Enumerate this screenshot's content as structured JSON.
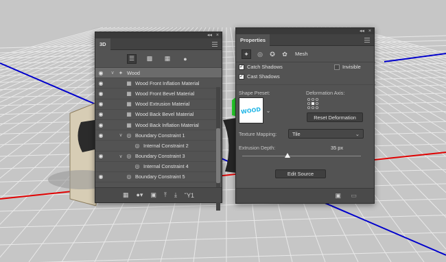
{
  "panel_3d": {
    "title": "3D",
    "collapse_label": "◂◂",
    "close_label": "×",
    "filter_icons": [
      "scene-filter-icon",
      "mesh-filter-icon",
      "material-filter-icon",
      "light-filter-icon"
    ],
    "layers": [
      {
        "label": "Wood",
        "icon": "✦",
        "twist": "∨",
        "eye": true,
        "indent": 0,
        "selected": true,
        "name": "layer-row-wood"
      },
      {
        "label": "Wood Front Inflation Material",
        "icon": "▦",
        "twist": "",
        "eye": true,
        "indent": 1,
        "name": "layer-row-front-inflation-material"
      },
      {
        "label": "Wood Front Bevel Material",
        "icon": "▦",
        "twist": "",
        "eye": true,
        "indent": 1,
        "name": "layer-row-front-bevel-material"
      },
      {
        "label": "Wood Extrusion Material",
        "icon": "▦",
        "twist": "",
        "eye": true,
        "indent": 1,
        "name": "layer-row-extrusion-material"
      },
      {
        "label": "Wood Back Bevel Material",
        "icon": "▦",
        "twist": "",
        "eye": true,
        "indent": 1,
        "name": "layer-row-back-bevel-material"
      },
      {
        "label": "Wood Back Inflation Material",
        "icon": "▦",
        "twist": "",
        "eye": true,
        "indent": 1,
        "name": "layer-row-back-inflation-material"
      },
      {
        "label": "Boundary Constraint 1",
        "icon": "◎",
        "twist": "∨",
        "eye": true,
        "indent": 1,
        "name": "layer-row-boundary-constraint-1"
      },
      {
        "label": "Internal Constraint 2",
        "icon": "◎",
        "twist": "",
        "eye": false,
        "indent": 2,
        "name": "layer-row-internal-constraint-2"
      },
      {
        "label": "Boundary Constraint 3",
        "icon": "◎",
        "twist": "∨",
        "eye": true,
        "indent": 1,
        "name": "layer-row-boundary-constraint-3"
      },
      {
        "label": "Internal Constraint 4",
        "icon": "◎",
        "twist": "",
        "eye": false,
        "indent": 2,
        "name": "layer-row-internal-constraint-4"
      },
      {
        "label": "Boundary Constraint 5",
        "icon": "◎",
        "twist": "",
        "eye": true,
        "indent": 1,
        "name": "layer-row-boundary-constraint-5"
      }
    ],
    "bottom_icons": [
      {
        "glyph": "▦",
        "name": "add-mesh-icon"
      },
      {
        "glyph": "●▾",
        "name": "add-light-icon"
      },
      {
        "glyph": "▣",
        "name": "material-library-icon"
      },
      {
        "glyph": "⤒",
        "name": "drop-to-ground-icon"
      },
      {
        "glyph": "⤓",
        "name": "split-extrusion-icon"
      },
      {
        "glyph": "Ὕ1",
        "name": "trash-icon"
      }
    ]
  },
  "properties": {
    "title": "Properties",
    "collapse_label": "◂◂",
    "close_label": "×",
    "mesh_label": "Mesh",
    "catch_shadows": "Catch Shadows",
    "cast_shadows": "Cast Shadows",
    "invisible": "Invisible",
    "shape_preset": "Shape Preset:",
    "deformation_axis": "Deformation Axis:",
    "reset_deformation": "Reset Deformation",
    "texture_mapping_label": "Texture Mapping:",
    "texture_mapping_value": "Tile",
    "extrusion_depth_label": "Extrusion Depth:",
    "extrusion_depth_value": "35 px",
    "extrusion_depth_fraction": 0.38,
    "edit_source": "Edit Source",
    "preset_text": "WOOD"
  },
  "colors": {
    "panel_bg": "#535353",
    "floor": "#c8c8c8",
    "axis_red": "#e00000",
    "axis_blue": "#0000cc"
  }
}
